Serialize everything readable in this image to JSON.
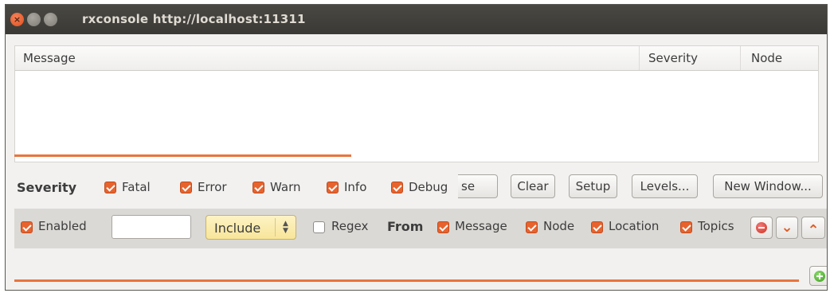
{
  "window": {
    "title": "rxconsole http://localhost:11311",
    "controls": {
      "close": "×",
      "minimize": "–",
      "maximize": "□"
    }
  },
  "table": {
    "columns": [
      "Message",
      "Severity",
      "Node"
    ]
  },
  "severity": {
    "label": "Severity",
    "levels": [
      {
        "label": "Fatal",
        "checked": true
      },
      {
        "label": "Error",
        "checked": true
      },
      {
        "label": "Warn",
        "checked": true
      },
      {
        "label": "Info",
        "checked": true
      },
      {
        "label": "Debug",
        "checked": true
      }
    ],
    "buttons": {
      "pause_partial": "se",
      "clear": "Clear",
      "setup": "Setup",
      "levels": "Levels...",
      "new_window": "New Window..."
    }
  },
  "filter": {
    "enabled_label": "Enabled",
    "enabled_checked": true,
    "text_value": "",
    "mode": "Include",
    "regex_label": "Regex",
    "regex_checked": false,
    "from_label": "From",
    "sources": [
      {
        "label": "Message",
        "checked": true
      },
      {
        "label": "Node",
        "checked": true
      },
      {
        "label": "Location",
        "checked": true
      },
      {
        "label": "Topics",
        "checked": true
      }
    ]
  },
  "colors": {
    "accent": "#e7632e",
    "progress": "#e9743d",
    "titlebar": "#3c3b37",
    "combo": "#f8e59a"
  }
}
